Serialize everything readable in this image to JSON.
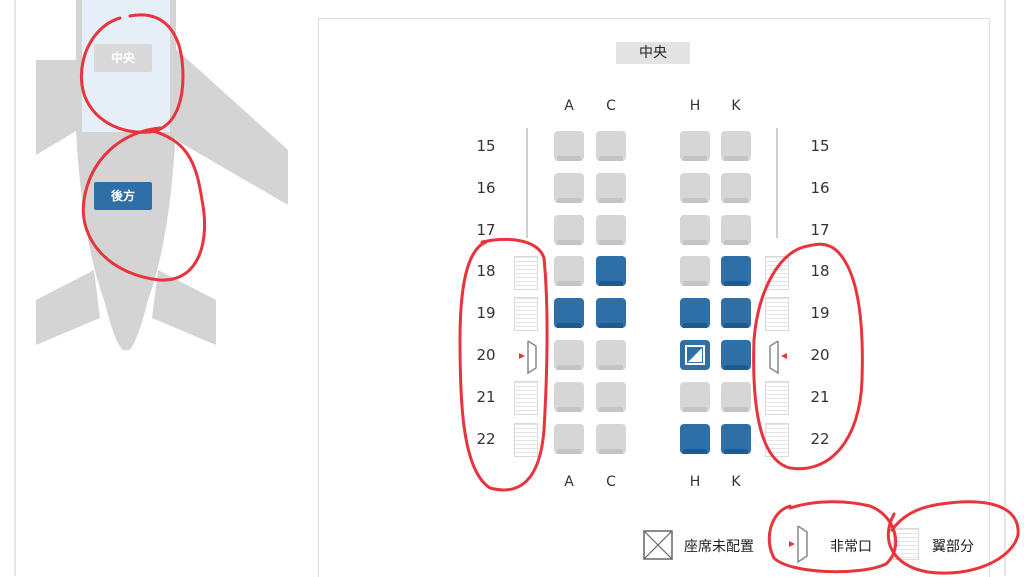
{
  "zones": {
    "middle_label": "中央",
    "rear_label": "後方"
  },
  "cabin": {
    "section_label": "中央",
    "columns": [
      "A",
      "C",
      "H",
      "K"
    ],
    "rows": [
      "15",
      "16",
      "17",
      "18",
      "19",
      "20",
      "21",
      "22"
    ],
    "seat_status": {
      "15": [
        "unavailable",
        "unavailable",
        "unavailable",
        "unavailable"
      ],
      "16": [
        "unavailable",
        "unavailable",
        "unavailable",
        "unavailable"
      ],
      "17": [
        "unavailable",
        "unavailable",
        "unavailable",
        "unavailable"
      ],
      "18": [
        "unavailable",
        "available",
        "unavailable",
        "available"
      ],
      "19": [
        "available",
        "available",
        "available",
        "available"
      ],
      "20": [
        "unavailable",
        "unavailable",
        "not-installed",
        "available"
      ],
      "21": [
        "unavailable",
        "unavailable",
        "unavailable",
        "unavailable"
      ],
      "22": [
        "unavailable",
        "unavailable",
        "available",
        "available"
      ]
    }
  },
  "legend": {
    "no_seat_label": "座席未配置",
    "exit_label": "非常口",
    "wing_label": "翼部分"
  },
  "colors": {
    "available": "#2f6fa8",
    "unavailable": "#d6d6d6",
    "annotation": "#e8343c"
  }
}
